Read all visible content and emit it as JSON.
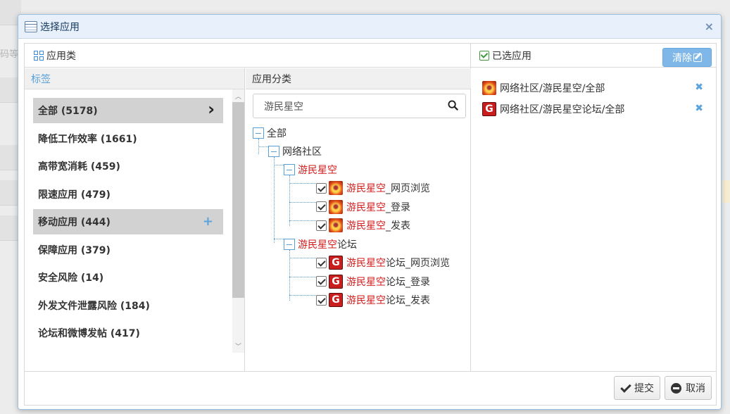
{
  "background": {
    "fragment_text": "码等等"
  },
  "dialog": {
    "title": "选择应用",
    "close_glyph": "×",
    "left_header": "应用类",
    "right_header": "已选应用",
    "clear_label": "清除"
  },
  "tags": {
    "header": "标签",
    "items": [
      {
        "label": "全部 (5178)",
        "active": true,
        "trail": "chevron-right-icon"
      },
      {
        "label": "降低工作效率 (1661)"
      },
      {
        "label": "高带宽消耗 (459)"
      },
      {
        "label": "限速应用 (479)"
      },
      {
        "label": "移动应用 (444)",
        "active": true,
        "trail": "plus-icon"
      },
      {
        "label": "保障应用 (379)"
      },
      {
        "label": "安全风险 (14)"
      },
      {
        "label": "外发文件泄露风险 (184)"
      },
      {
        "label": "论坛和微博发帖 (417)"
      }
    ]
  },
  "categories": {
    "header": "应用分类",
    "search_value": "游民星空",
    "tree": {
      "root": "全部",
      "level1": "网络社区",
      "highlight": "游民星空",
      "group1": {
        "label": "游民星空",
        "children": [
          {
            "hl": "游民星空",
            "rest": "_网页浏览"
          },
          {
            "hl": "游民星空",
            "rest": "_登录"
          },
          {
            "hl": "游民星空",
            "rest": "_发表"
          }
        ]
      },
      "group2": {
        "hl": "游民星空",
        "rest": "论坛",
        "children": [
          {
            "hl": "游民星空",
            "rest": "论坛_网页浏览"
          },
          {
            "hl": "游民星空",
            "rest": "论坛_登录"
          },
          {
            "hl": "游民星空",
            "rest": "论坛_发表"
          }
        ]
      }
    }
  },
  "selected": [
    {
      "label": "网络社区/游民星空/全部",
      "icon": "gamersky-icon"
    },
    {
      "label": "网络社区/游民星空论坛/全部",
      "icon": "g-icon",
      "glyph": "G"
    }
  ],
  "footer": {
    "submit_label": "提交",
    "cancel_label": "取消"
  },
  "colors": {
    "accent": "#5aa0d8",
    "highlight_red": "#d21d1d",
    "active_bg": "#d2d2d2"
  }
}
